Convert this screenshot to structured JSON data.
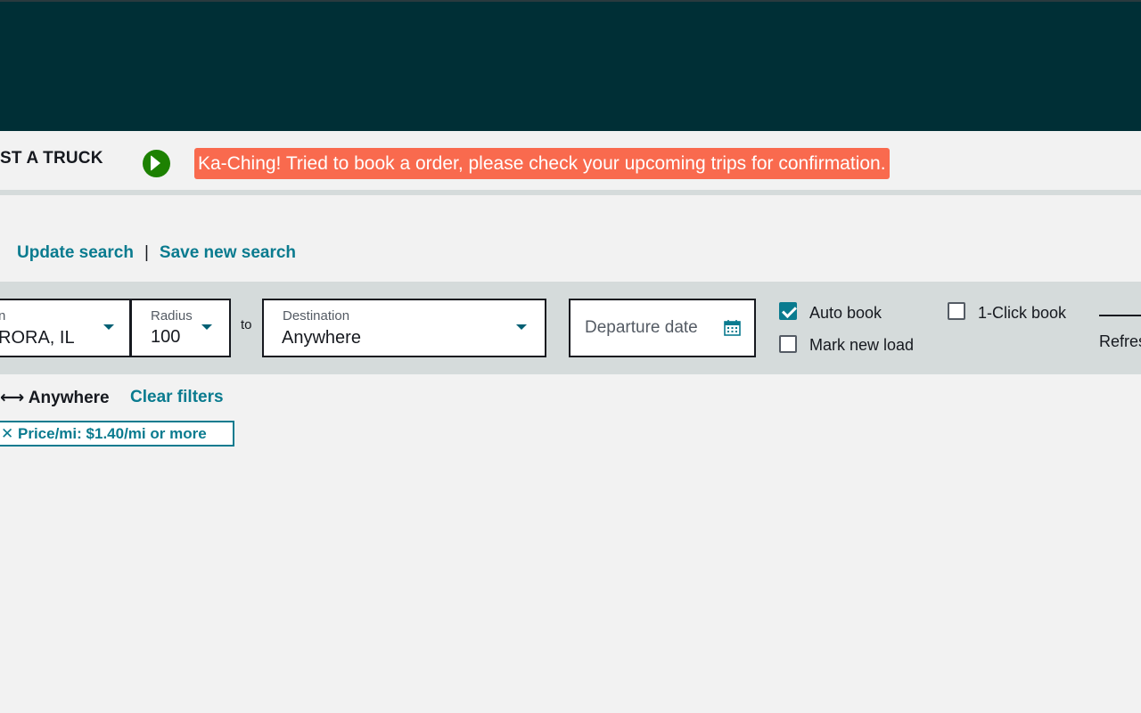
{
  "header": {
    "post_truck_label": "ST A TRUCK"
  },
  "notification": {
    "message": "Ka-Ching! Tried to book a order, please check your upcoming trips for confirmation.",
    "play_icon": "play-circle-icon",
    "color": "#f96a4e"
  },
  "search_links": {
    "update": "Update search",
    "separator": "|",
    "save_new": "Save new search"
  },
  "filters": {
    "origin": {
      "label": "n",
      "value": "RORA, IL"
    },
    "radius": {
      "label": "Radius",
      "value": "100"
    },
    "to_label": "to",
    "destination": {
      "label": "Destination",
      "value": "Anywhere"
    },
    "departure": {
      "placeholder": "Departure date",
      "icon": "calendar-icon"
    },
    "auto_book": {
      "label": "Auto book",
      "checked": true
    },
    "one_click_book": {
      "label": "1-Click book",
      "checked": false
    },
    "mark_new_load": {
      "label": "Mark new load",
      "checked": false
    },
    "refresh_label": "Refres"
  },
  "applied": {
    "route_summary": "⟷ Anywhere",
    "clear_filters": "Clear filters",
    "chip_close": "✕",
    "chip_text": "Price/mi: $1.40/mi or more"
  },
  "colors": {
    "header_bg": "#002f36",
    "accent": "#0a7b8f",
    "play_green": "#1d8102"
  }
}
